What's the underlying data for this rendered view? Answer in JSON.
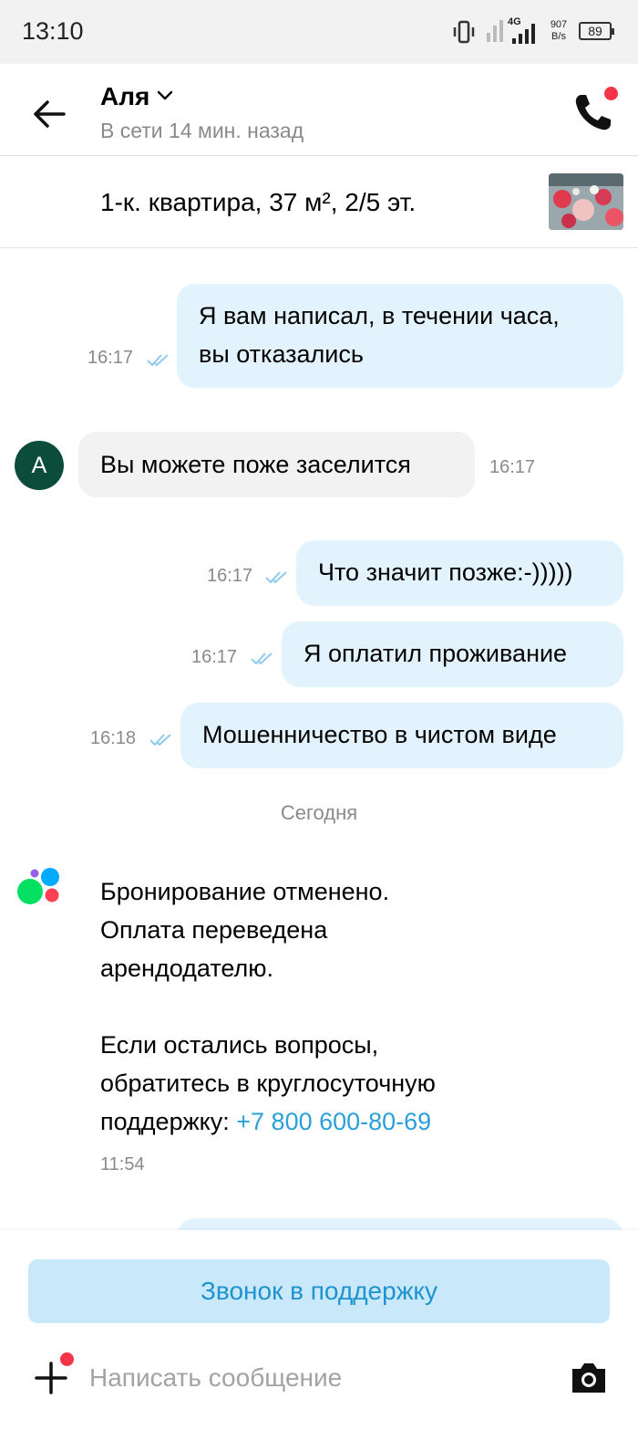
{
  "status_bar": {
    "time": "13:10",
    "network": "4G",
    "speed_value": "907",
    "speed_unit": "B/s",
    "battery": "89"
  },
  "header": {
    "contact_name": "Аля",
    "last_seen": "В сети 14 мин. назад"
  },
  "listing": {
    "title": "1-к. квартира, 37 м², 2/5 эт."
  },
  "messages": [
    {
      "direction": "out",
      "text_line1": "Я вам написал, в течении часа,",
      "text_line2": "вы отказались",
      "time": "16:17",
      "status": "read"
    },
    {
      "direction": "in",
      "avatar_letter": "А",
      "text": "Вы можете поже заселится",
      "time": "16:17"
    },
    {
      "direction": "out",
      "text": "Что значит позже:-)))))",
      "time": "16:17",
      "status": "read"
    },
    {
      "direction": "out",
      "text": "Я оплатил проживание",
      "time": "16:17",
      "status": "read"
    },
    {
      "direction": "out",
      "text": "Мошенничество в чистом виде",
      "time": "16:18",
      "status": "read"
    }
  ],
  "date_separator": "Сегодня",
  "system_message": {
    "line1": "Бронирование отменено.",
    "line2": "Оплата переведена",
    "line3": "арендодателю.",
    "line4": "Если остались вопросы,",
    "line5": "обратитесь в круглосуточную",
    "line6_prefix": "поддержку: ",
    "phone": "+7 800 600-80-69",
    "time": "11:54"
  },
  "bottom": {
    "support_button": "Звонок в поддержку",
    "input_placeholder": "Написать сообщение"
  },
  "colors": {
    "outgoing_bubble": "#e3f3fd",
    "incoming_bubble": "#f2f2f2",
    "accent_blue": "#2a9fd8",
    "support_button_bg": "#c9e9fb",
    "notification_dot": "#f5344a",
    "avatar_bg": "#0b4d3a"
  },
  "icons": [
    "back-arrow-icon",
    "chevron-down-icon",
    "phone-icon",
    "double-check-icon",
    "plus-icon",
    "camera-icon",
    "avito-logo-icon"
  ]
}
